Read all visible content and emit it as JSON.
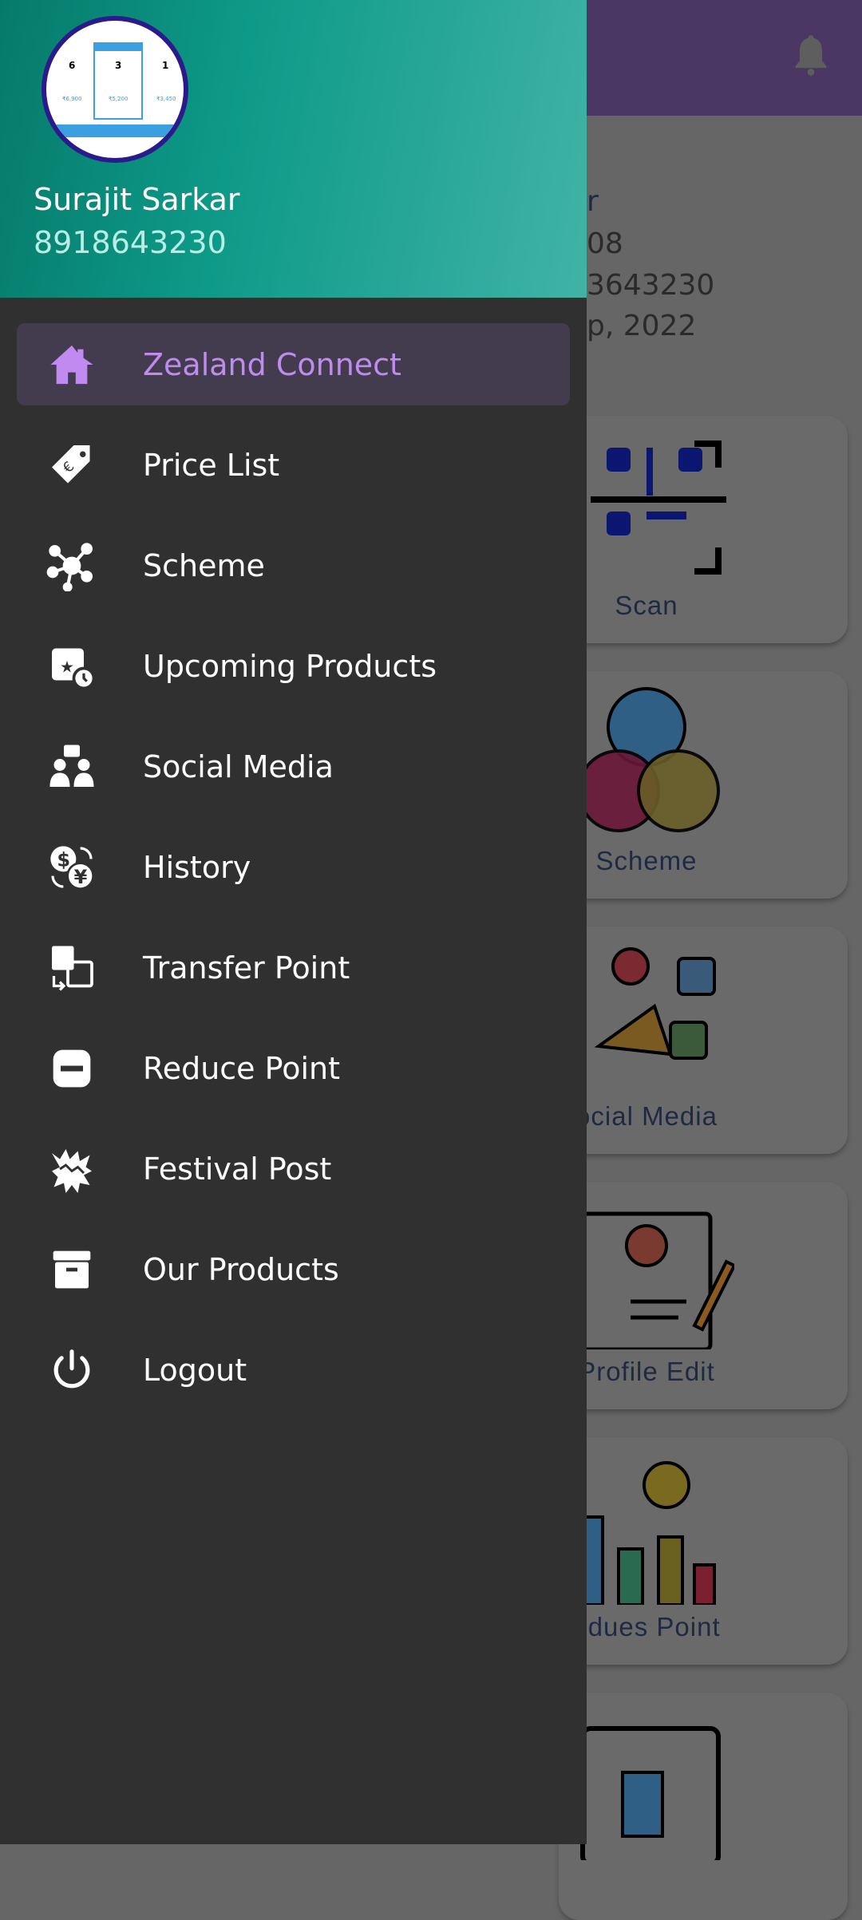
{
  "drawer": {
    "user_name": "Surajit Sarkar",
    "user_phone": "8918643230",
    "accent": "#c08af0",
    "items": [
      {
        "label": "Zealand Connect",
        "icon": "home-icon",
        "active": true
      },
      {
        "label": "Price List",
        "icon": "price-tag-icon"
      },
      {
        "label": "Scheme",
        "icon": "network-icon"
      },
      {
        "label": "Upcoming Products",
        "icon": "calendar-star-icon"
      },
      {
        "label": "Social Media",
        "icon": "people-chat-icon"
      },
      {
        "label": "History",
        "icon": "currency-exchange-icon"
      },
      {
        "label": "Transfer Point",
        "icon": "transfer-icon"
      },
      {
        "label": "Reduce Point",
        "icon": "minus-box-icon"
      },
      {
        "label": "Festival Post",
        "icon": "festival-icon"
      },
      {
        "label": "Our Products",
        "icon": "archive-icon"
      },
      {
        "label": "Logout",
        "icon": "power-icon"
      }
    ]
  },
  "background": {
    "profile_lines": [
      "r",
      "08",
      "3643230",
      "p, 2022"
    ],
    "cards": [
      "Scan",
      "Scheme",
      "ocial Media",
      "Profile Edit",
      "edues Point",
      ""
    ]
  }
}
